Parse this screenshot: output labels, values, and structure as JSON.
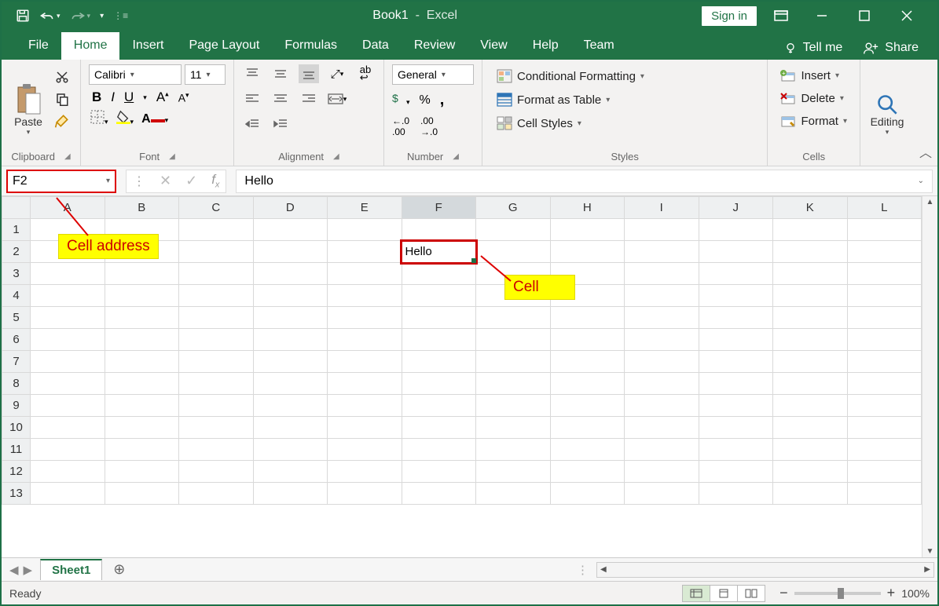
{
  "title": {
    "doc": "Book1",
    "app": "Excel"
  },
  "signin": "Sign in",
  "tabs": {
    "file": "File",
    "home": "Home",
    "insert": "Insert",
    "pageLayout": "Page Layout",
    "formulas": "Formulas",
    "data": "Data",
    "review": "Review",
    "view": "View",
    "help": "Help",
    "team": "Team",
    "tellme": "Tell me",
    "share": "Share"
  },
  "ribbon": {
    "clipboard": {
      "paste": "Paste",
      "label": "Clipboard"
    },
    "font": {
      "name": "Calibri",
      "size": "11",
      "label": "Font"
    },
    "alignment": {
      "label": "Alignment"
    },
    "number": {
      "format": "General",
      "label": "Number"
    },
    "styles": {
      "cond": "Conditional Formatting",
      "table": "Format as Table",
      "cell": "Cell Styles",
      "label": "Styles"
    },
    "cells": {
      "insert": "Insert",
      "delete": "Delete",
      "format": "Format",
      "label": "Cells"
    },
    "editing": {
      "label": "Editing"
    }
  },
  "nameBox": "F2",
  "formula": "Hello",
  "columns": [
    "A",
    "B",
    "C",
    "D",
    "E",
    "F",
    "G",
    "H",
    "I",
    "J",
    "K",
    "L"
  ],
  "rows": [
    "1",
    "2",
    "3",
    "4",
    "5",
    "6",
    "7",
    "8",
    "9",
    "10",
    "11",
    "12",
    "13"
  ],
  "selectedCell": {
    "row": 2,
    "col": "F",
    "value": "Hello"
  },
  "annotations": {
    "cellAddress": "Cell address",
    "cell": "Cell"
  },
  "sheetTab": "Sheet1",
  "status": "Ready",
  "zoom": "100%"
}
